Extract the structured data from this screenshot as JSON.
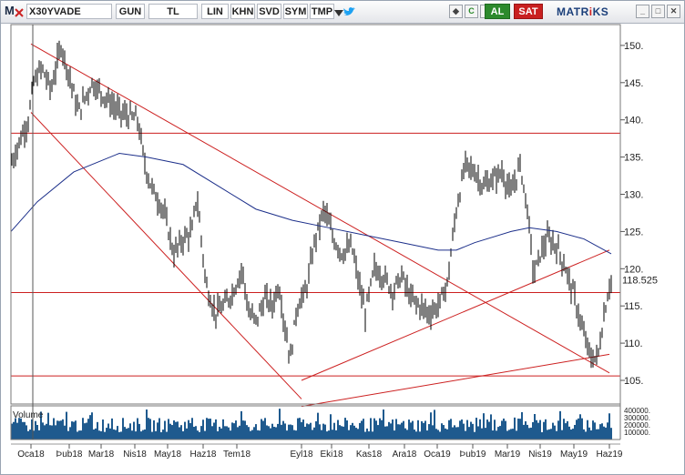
{
  "toolbar": {
    "app_letter": "M",
    "symbol": "X30YVADE",
    "period": "GUN",
    "currency": "TL",
    "scale": "LIN",
    "buttons": [
      "KHN",
      "SVD",
      "SYM",
      "TMP"
    ],
    "buy_label": "AL",
    "sell_label": "SAT",
    "brand": "MATR",
    "brand_i": "i",
    "brand_end": "KS",
    "refresh_label": "C",
    "dollar_label": "$",
    "window_controls": [
      "_",
      "□",
      "✕"
    ]
  },
  "chart_data": {
    "type": "candlestick",
    "last_price": "118.525",
    "y_ticks": [
      "105.",
      "110.",
      "115.",
      "120.",
      "125.",
      "130.",
      "135.",
      "140.",
      "145.",
      "150."
    ],
    "x_ticks": [
      "Oca18",
      "Þub18",
      "Mar18",
      "Nis18",
      "May18",
      "Haz18",
      "Tem18",
      "Eyl18",
      "Eki18",
      "Kas18",
      "Ara18",
      "Oca19",
      "Þub19",
      "Mar19",
      "Nis19",
      "May19",
      "Haz19"
    ],
    "volume_label": "Volume",
    "volume_ticks": [
      "400000.",
      "300000.",
      "200000.",
      "100000."
    ],
    "moving_average_color": "#1c2f8a",
    "trendline_color": "#cc1f1f",
    "price_color": "#000000",
    "volume_color": "#1f5a8e",
    "horizontal_levels": [
      138.2,
      116.8,
      105.6
    ],
    "trendlines": [
      {
        "from": [
          "Oca18",
          150.2
        ],
        "to": [
          "Haz19",
          106.0
        ]
      },
      {
        "from": [
          "Oca18",
          141.0
        ],
        "to": [
          "Eyl18",
          102.5
        ]
      },
      {
        "from": [
          "Eyl18",
          105.0
        ],
        "to": [
          "Haz19",
          122.5
        ]
      },
      {
        "from": [
          "Eyl18",
          101.5
        ],
        "to": [
          "Haz19",
          108.5
        ]
      }
    ]
  }
}
